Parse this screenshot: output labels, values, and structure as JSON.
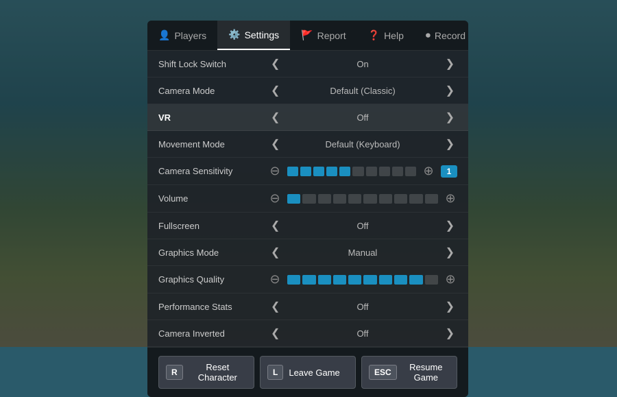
{
  "background": {
    "color": "#3a7080"
  },
  "tabs": [
    {
      "id": "players",
      "label": "Players",
      "icon": "👤",
      "active": false
    },
    {
      "id": "settings",
      "label": "Settings",
      "icon": "⚙️",
      "active": true
    },
    {
      "id": "report",
      "label": "Report",
      "icon": "🚩",
      "active": false
    },
    {
      "id": "help",
      "label": "Help",
      "icon": "❓",
      "active": false
    },
    {
      "id": "record",
      "label": "Record",
      "icon": "⏺",
      "active": false
    }
  ],
  "settings": [
    {
      "id": "shift-lock",
      "label": "Shift Lock Switch",
      "type": "toggle",
      "value": "On",
      "highlighted": false
    },
    {
      "id": "camera-mode",
      "label": "Camera Mode",
      "type": "toggle",
      "value": "Default (Classic)",
      "highlighted": false
    },
    {
      "id": "vr",
      "label": "VR",
      "type": "toggle",
      "value": "Off",
      "highlighted": true
    },
    {
      "id": "movement-mode",
      "label": "Movement Mode",
      "type": "toggle",
      "value": "Default (Keyboard)",
      "highlighted": false
    },
    {
      "id": "camera-sensitivity",
      "label": "Camera Sensitivity",
      "type": "slider",
      "filledSegments": 5,
      "totalSegments": 10,
      "sliderValue": "1",
      "highlighted": false
    },
    {
      "id": "volume",
      "label": "Volume",
      "type": "slider",
      "filledSegments": 1,
      "totalSegments": 10,
      "sliderValue": null,
      "highlighted": false
    },
    {
      "id": "fullscreen",
      "label": "Fullscreen",
      "type": "toggle",
      "value": "Off",
      "highlighted": false
    },
    {
      "id": "graphics-mode",
      "label": "Graphics Mode",
      "type": "toggle",
      "value": "Manual",
      "highlighted": false
    },
    {
      "id": "graphics-quality",
      "label": "Graphics Quality",
      "type": "slider",
      "filledSegments": 9,
      "totalSegments": 10,
      "sliderValue": null,
      "highlighted": false
    },
    {
      "id": "performance-stats",
      "label": "Performance Stats",
      "type": "toggle",
      "value": "Off",
      "highlighted": false
    },
    {
      "id": "camera-inverted",
      "label": "Camera Inverted",
      "type": "toggle",
      "value": "Off",
      "highlighted": false
    }
  ],
  "footer": [
    {
      "id": "reset",
      "key": "R",
      "label": "Reset Character"
    },
    {
      "id": "leave",
      "key": "L",
      "label": "Leave Game"
    },
    {
      "id": "resume",
      "key": "ESC",
      "label": "Resume Game"
    }
  ]
}
